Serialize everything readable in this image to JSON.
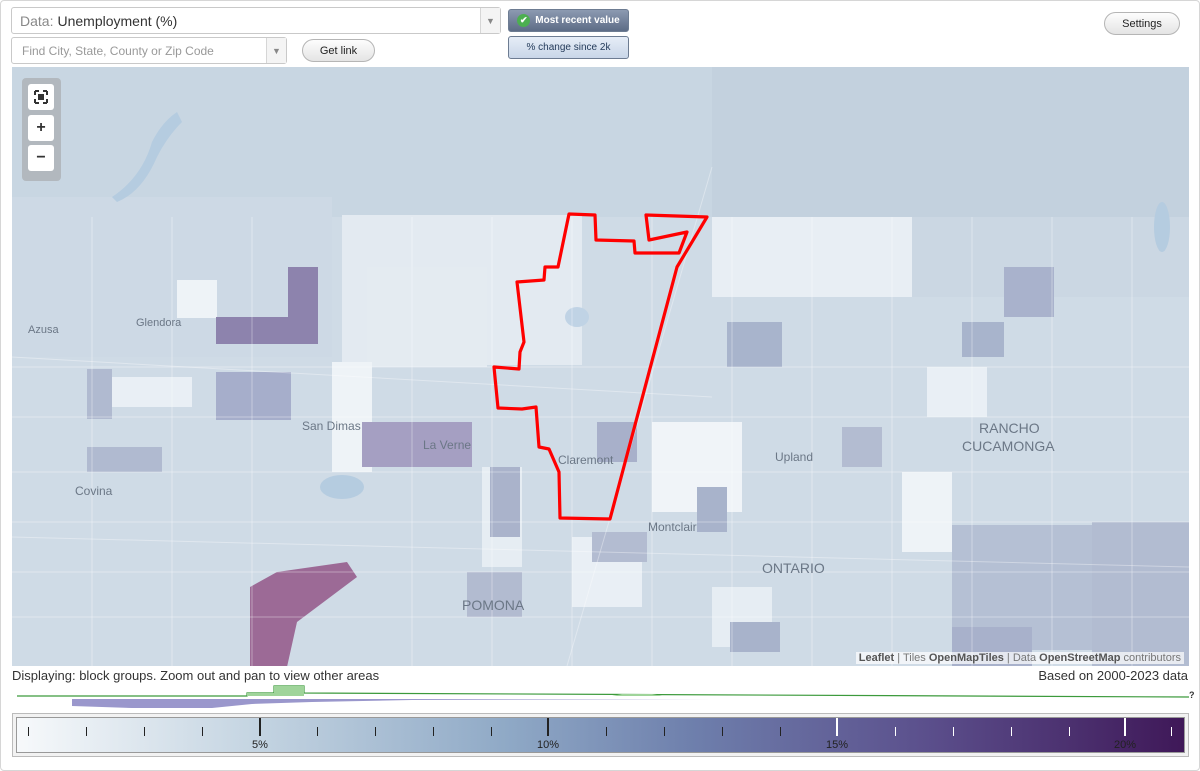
{
  "controls": {
    "data_prefix": "Data:",
    "data_value": "Unemployment (%)",
    "search_placeholder": "Find City, State, County or Zip Code",
    "get_link": "Get link",
    "settings": "Settings",
    "toggle_recent": "Most recent value",
    "toggle_change": "% change since 2k"
  },
  "map": {
    "places": [
      "Azusa",
      "Glendora",
      "San Dimas",
      "La Verne",
      "Claremont",
      "Upland",
      "RANCHO",
      "CUCAMONGA",
      "Covina",
      "Montclair",
      "ONTARIO",
      "POMONA"
    ],
    "attribution": {
      "leaflet": "Leaflet",
      "tiles_label": "Tiles",
      "tiles": "OpenMapTiles",
      "data_label": "Data",
      "data": "OpenStreetMap",
      "contributors": "contributors"
    },
    "highlight_color": "#ff0000"
  },
  "status": {
    "displaying": "Displaying: block groups. Zoom out and pan to view other areas",
    "based_on": "Based on 2000-2023 data",
    "question": "?"
  },
  "legend": {
    "labels": [
      "5%",
      "10%",
      "15%",
      "20%"
    ]
  }
}
